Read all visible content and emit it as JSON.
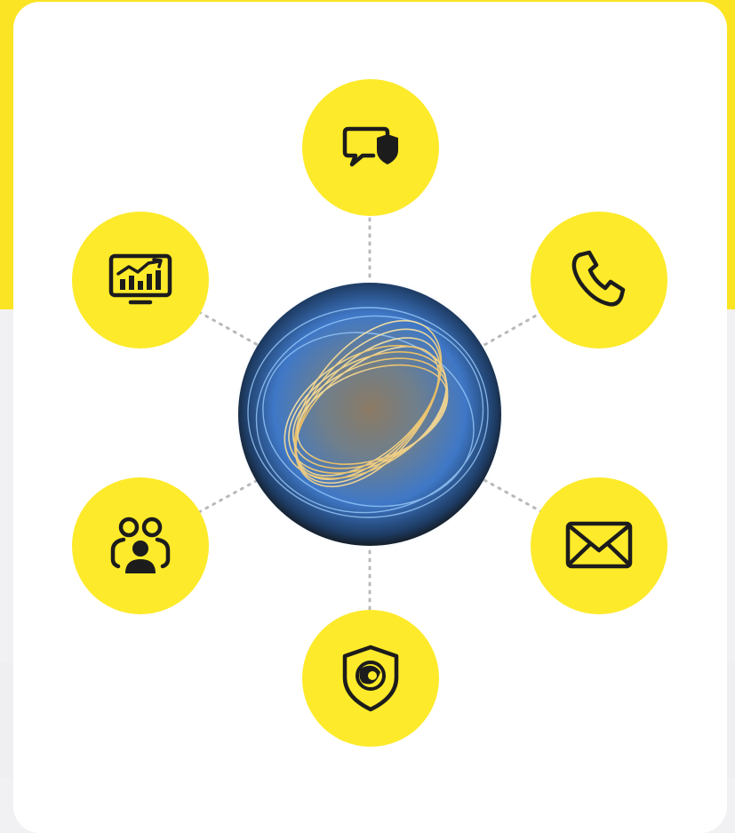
{
  "colors": {
    "page_accent": "#fbe423",
    "node_fill": "#fdea2a",
    "icon_stroke": "#1c1c1c",
    "connector": "#b9b9bd",
    "card": "#ffffff",
    "band": "#efeff1"
  },
  "hub": {
    "icon": "ai-orb-icon"
  },
  "nodes": [
    {
      "id": "chat",
      "icon": "secure-chat-icon"
    },
    {
      "id": "analytics",
      "icon": "analytics-monitor-icon"
    },
    {
      "id": "phone",
      "icon": "phone-icon"
    },
    {
      "id": "team",
      "icon": "team-users-icon"
    },
    {
      "id": "mail",
      "icon": "mail-icon"
    },
    {
      "id": "security",
      "icon": "shield-orb-icon"
    }
  ]
}
